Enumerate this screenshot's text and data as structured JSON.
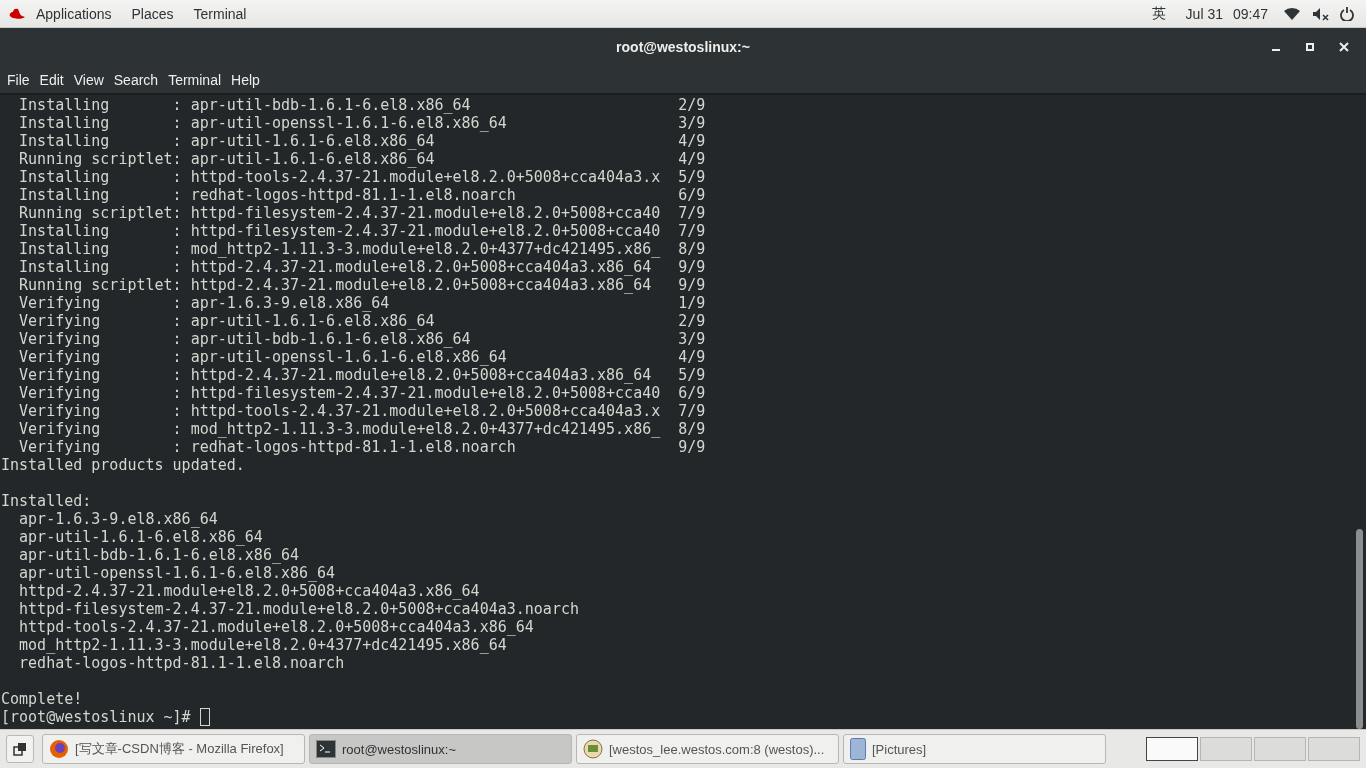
{
  "top_bar": {
    "menus": [
      "Applications",
      "Places",
      "Terminal"
    ],
    "input_method": "英",
    "date": "Jul 31",
    "time": "09:47"
  },
  "window": {
    "title": "root@westoslinux:~"
  },
  "menu_bar": [
    "File",
    "Edit",
    "View",
    "Search",
    "Terminal",
    "Help"
  ],
  "terminal": {
    "blocks": [
      [
        "  Installing       : apr-util-bdb-1.6.1-6.el8.x86_64                       2/9",
        "  Installing       : apr-util-openssl-1.6.1-6.el8.x86_64                   3/9",
        "  Installing       : apr-util-1.6.1-6.el8.x86_64                           4/9",
        "  Running scriptlet: apr-util-1.6.1-6.el8.x86_64                           4/9",
        "  Installing       : httpd-tools-2.4.37-21.module+el8.2.0+5008+cca404a3.x  5/9",
        "  Installing       : redhat-logos-httpd-81.1-1.el8.noarch                  6/9",
        "  Running scriptlet: httpd-filesystem-2.4.37-21.module+el8.2.0+5008+cca40  7/9",
        "  Installing       : httpd-filesystem-2.4.37-21.module+el8.2.0+5008+cca40  7/9",
        "  Installing       : mod_http2-1.11.3-3.module+el8.2.0+4377+dc421495.x86_  8/9",
        "  Installing       : httpd-2.4.37-21.module+el8.2.0+5008+cca404a3.x86_64   9/9",
        "  Running scriptlet: httpd-2.4.37-21.module+el8.2.0+5008+cca404a3.x86_64   9/9",
        "  Verifying        : apr-1.6.3-9.el8.x86_64                                1/9",
        "  Verifying        : apr-util-1.6.1-6.el8.x86_64                           2/9",
        "  Verifying        : apr-util-bdb-1.6.1-6.el8.x86_64                       3/9",
        "  Verifying        : apr-util-openssl-1.6.1-6.el8.x86_64                   4/9",
        "  Verifying        : httpd-2.4.37-21.module+el8.2.0+5008+cca404a3.x86_64   5/9",
        "  Verifying        : httpd-filesystem-2.4.37-21.module+el8.2.0+5008+cca40  6/9",
        "  Verifying        : httpd-tools-2.4.37-21.module+el8.2.0+5008+cca404a3.x  7/9",
        "  Verifying        : mod_http2-1.11.3-3.module+el8.2.0+4377+dc421495.x86_  8/9",
        "  Verifying        : redhat-logos-httpd-81.1-1.el8.noarch                  9/9",
        "Installed products updated."
      ],
      [
        "Installed:",
        "  apr-1.6.3-9.el8.x86_64",
        "  apr-util-1.6.1-6.el8.x86_64",
        "  apr-util-bdb-1.6.1-6.el8.x86_64",
        "  apr-util-openssl-1.6.1-6.el8.x86_64",
        "  httpd-2.4.37-21.module+el8.2.0+5008+cca404a3.x86_64",
        "  httpd-filesystem-2.4.37-21.module+el8.2.0+5008+cca404a3.noarch",
        "  httpd-tools-2.4.37-21.module+el8.2.0+5008+cca404a3.x86_64",
        "  mod_http2-1.11.3-3.module+el8.2.0+4377+dc421495.x86_64",
        "  redhat-logos-httpd-81.1-1.el8.noarch"
      ],
      [
        "Complete!"
      ]
    ],
    "prompt": "[root@westoslinux ~]# "
  },
  "taskbar": {
    "items": [
      {
        "kind": "browser",
        "label": "[写文章-CSDN博客 - Mozilla Firefox]",
        "selected": false
      },
      {
        "kind": "terminal",
        "label": "root@westoslinux:~",
        "selected": true
      },
      {
        "kind": "viewer",
        "label": "[westos_lee.westos.com:8 (westos)...",
        "selected": false
      },
      {
        "kind": "files",
        "label": "[Pictures]",
        "selected": false
      }
    ],
    "workspaces": [
      {
        "selected": true
      },
      {
        "selected": false
      },
      {
        "selected": false
      },
      {
        "selected": false
      }
    ]
  }
}
